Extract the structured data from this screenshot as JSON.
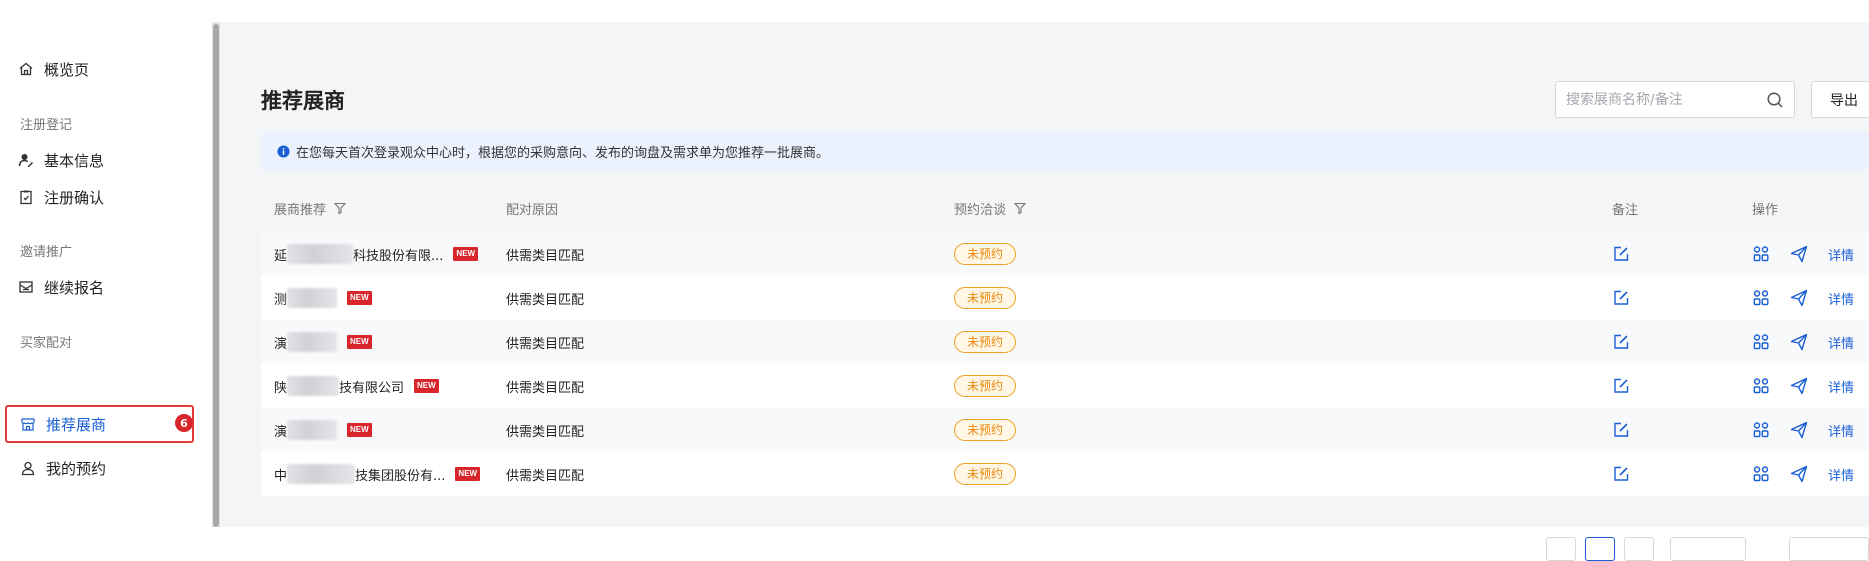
{
  "sidebar": {
    "overview": "概览页",
    "group_register": "注册登记",
    "basic_info": "基本信息",
    "register_confirm": "注册确认",
    "group_invite": "邀请推广",
    "continue_signup": "继续报名",
    "group_match": "买家配对",
    "recommended_exhibitors": "推荐展商",
    "recommended_badge": "6",
    "my_appointments": "我的预约"
  },
  "main": {
    "title": "推荐展商",
    "search_placeholder": "搜索展商名称/备注",
    "export_label": "导出",
    "notice": "在您每天首次登录观众中心时，根据您的采购意向、发布的询盘及需求单为您推荐一批展商。"
  },
  "table": {
    "headers": [
      "展商推荐",
      "配对原因",
      "预约洽谈",
      "备注",
      "操作"
    ],
    "rows": [
      {
        "name_prefix": "延",
        "name_suffix": "科技股份有限...",
        "new": "NEW",
        "reason": "供需类目匹配",
        "status": "未预约",
        "detail": "详情"
      },
      {
        "name_prefix": "测",
        "name_suffix": "",
        "new": "NEW",
        "reason": "供需类目匹配",
        "status": "未预约",
        "detail": "详情"
      },
      {
        "name_prefix": "演",
        "name_suffix": "",
        "new": "NEW",
        "reason": "供需类目匹配",
        "status": "未预约",
        "detail": "详情"
      },
      {
        "name_prefix": "陕",
        "name_suffix": "技有限公司",
        "new": "NEW",
        "reason": "供需类目匹配",
        "status": "未预约",
        "detail": "详情"
      },
      {
        "name_prefix": "演",
        "name_suffix": "",
        "new": "NEW",
        "reason": "供需类目匹配",
        "status": "未预约",
        "detail": "详情"
      },
      {
        "name_prefix": "中",
        "name_suffix": "技集团股份有...",
        "new": "NEW",
        "reason": "供需类目匹配",
        "status": "未预约",
        "detail": "详情"
      }
    ]
  },
  "icons": {
    "accent_color": "#1a5fd6",
    "highlight_border": "#e63a3a",
    "status_color": "#e8890c"
  }
}
